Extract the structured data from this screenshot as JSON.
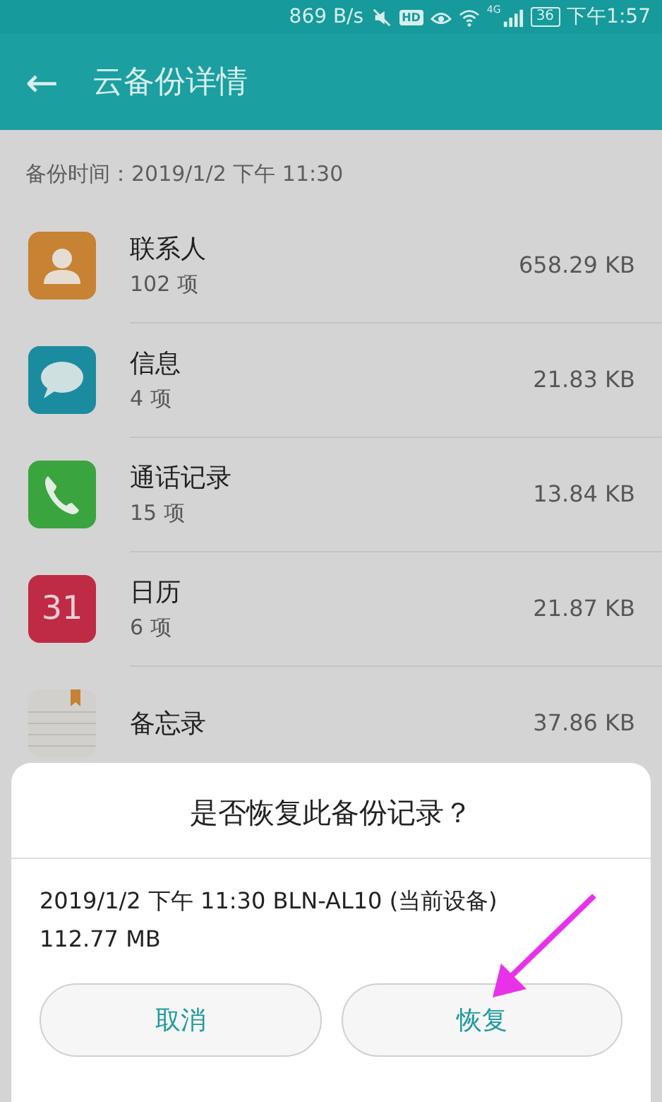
{
  "status_bar": {
    "speed": "869 B/s",
    "hd": "HD",
    "network": "4G",
    "battery": "36",
    "time": "下午1:57"
  },
  "header": {
    "back": "←",
    "title": "云备份详情"
  },
  "backup_time": "备份时间：2019/1/2 下午 11:30",
  "items": [
    {
      "kind": "contacts",
      "name": "联系人",
      "count": "102 项",
      "size": "658.29 KB"
    },
    {
      "kind": "messages",
      "name": "信息",
      "count": "4 项",
      "size": "21.83 KB"
    },
    {
      "kind": "calls",
      "name": "通话记录",
      "count": "15 项",
      "size": "13.84 KB"
    },
    {
      "kind": "calendar",
      "icon_text": "31",
      "name": "日历",
      "count": "6 项",
      "size": "21.87 KB"
    },
    {
      "kind": "notes",
      "name": "备忘录",
      "size": "37.86 KB"
    }
  ],
  "dialog": {
    "title": "是否恢复此备份记录？",
    "detail": "2019/1/2 下午 11:30  BLN-AL10 (当前设备)",
    "size": "112.77 MB",
    "buttons": [
      "取消",
      "恢复"
    ]
  }
}
